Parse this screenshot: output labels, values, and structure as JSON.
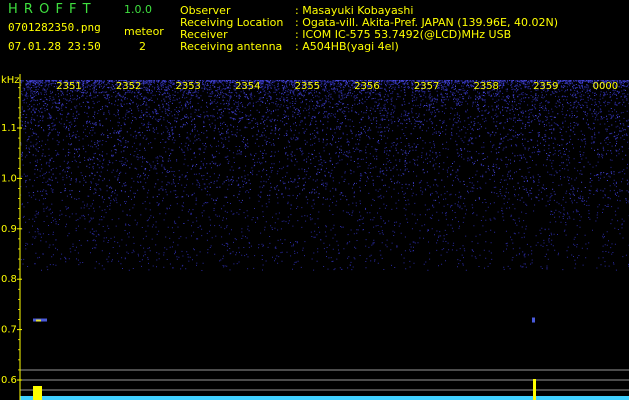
{
  "app": {
    "name": "H R O F F T",
    "version": "1.0.0"
  },
  "file": {
    "name": "0701282350.png",
    "datetime": "07.01.28 23:50"
  },
  "meteor": {
    "label": "meteor",
    "count": "2"
  },
  "station": [
    {
      "label": "Observer",
      "value": ": Masayuki Kobayashi"
    },
    {
      "label": "Receiving Location",
      "value": ": Ogata-vill. Akita-Pref. JAPAN (139.96E, 40.02N)"
    },
    {
      "label": "Receiver",
      "value": ": ICOM IC-575 53.7492(@LCD)MHz USB"
    },
    {
      "label": "Receiving antenna",
      "value": ": A504HB(yagi 4el)"
    }
  ],
  "chart_data": {
    "type": "heatmap",
    "x_unit": "time (HHMM)",
    "x_ticks": [
      "2351",
      "2352",
      "2353",
      "2354",
      "2355",
      "2356",
      "2357",
      "2358",
      "2359",
      "0000"
    ],
    "y_unit": "kHz",
    "y_ticks": [
      "1.1",
      "1.0",
      "0.9",
      "0.8",
      "0.7",
      "0.6"
    ],
    "ylim": [
      0.58,
      1.2
    ],
    "meteor_echoes": [
      {
        "time": "2350.3",
        "freq_khz": 0.72
      },
      {
        "time": "2359.0",
        "freq_khz": 0.72
      }
    ],
    "colors": {
      "background": "#000000",
      "noise": "#2a2aa0",
      "axis_text": "#ffff00",
      "guide_lines": "#c8c8c8",
      "baseline": "#40d0ff",
      "level_marks": "#ffff00"
    }
  }
}
